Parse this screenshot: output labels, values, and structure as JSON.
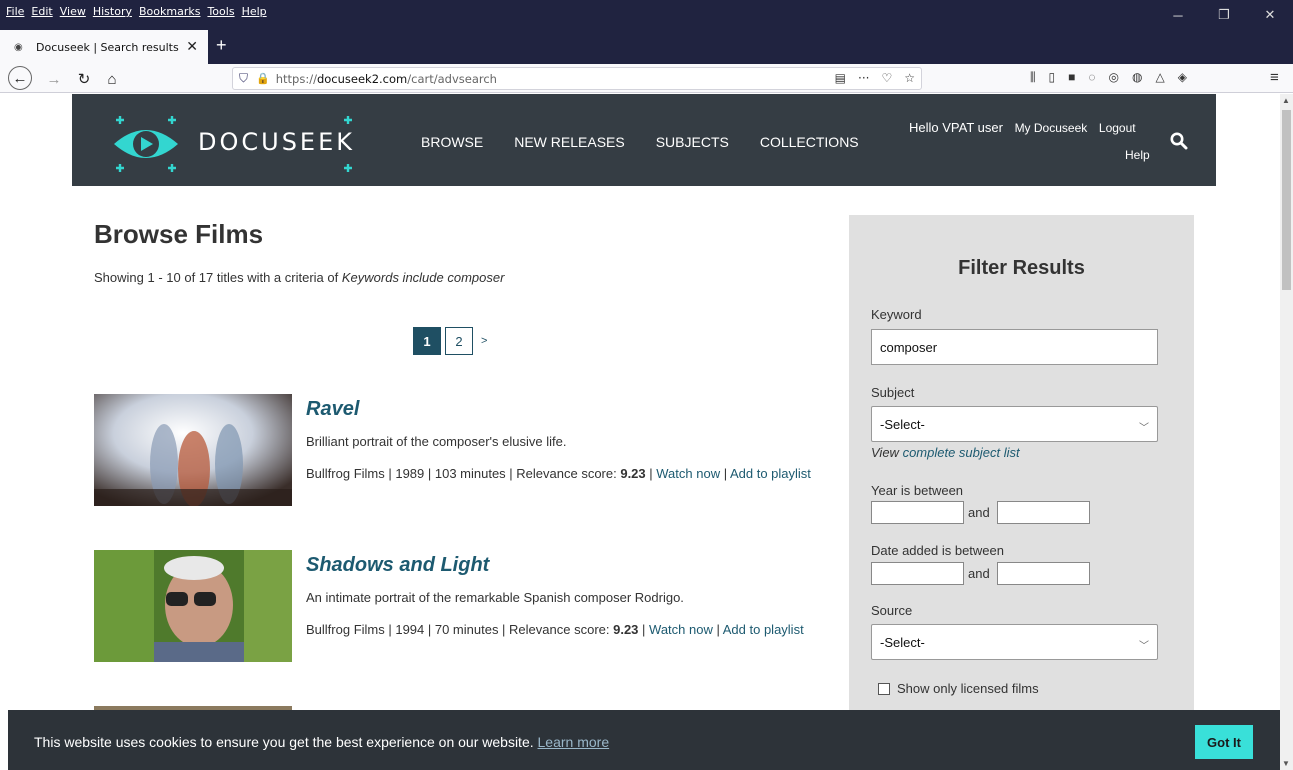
{
  "browser": {
    "menu": [
      "File",
      "Edit",
      "View",
      "History",
      "Bookmarks",
      "Tools",
      "Help"
    ],
    "tab_title": "Docuseek | Search results",
    "url_prefix": "https://",
    "url_domain": "docuseek2.com",
    "url_path": "/cart/advsearch",
    "url_more": "···"
  },
  "header": {
    "logo_text": "DOCUSEEK",
    "nav": [
      "BROWSE",
      "NEW RELEASES",
      "SUBJECTS",
      "COLLECTIONS"
    ],
    "greeting": "Hello VPAT user",
    "my_docuseek": "My Docuseek",
    "logout": "Logout",
    "help": "Help"
  },
  "main": {
    "title": "Browse Films",
    "showing": "Showing 1 - 10 of 17 titles with a criteria of ",
    "criteria": "Keywords include composer",
    "pager": {
      "current": "1",
      "other": "2",
      "next": ">"
    },
    "films": [
      {
        "title": "Ravel",
        "description": "Brilliant portrait of the composer's elusive life.",
        "meta": "Bullfrog Films | 1989 | 103 minutes | Relevance score: ",
        "score": "9.23",
        "sep": " | ",
        "watch": "Watch now",
        "add": "Add to playlist"
      },
      {
        "title": "Shadows and Light",
        "description": "An intimate portrait of the remarkable Spanish composer Rodrigo.",
        "meta": "Bullfrog Films | 1994 | 70 minutes | Relevance score: ",
        "score": "9.23",
        "sep": " | ",
        "watch": "Watch now",
        "add": "Add to playlist"
      }
    ]
  },
  "filter": {
    "heading": "Filter Results",
    "keyword_label": "Keyword",
    "keyword_value": "composer",
    "subject_label": "Subject",
    "subject_value": "-Select-",
    "view_text": "View ",
    "subject_link": "complete subject list",
    "year_label": "Year is between",
    "and": "and",
    "date_label": "Date added is between",
    "source_label": "Source",
    "source_value": "-Select-",
    "licensed_label": "Show only licensed films"
  },
  "cookie": {
    "message": "This website uses cookies to ensure you get the best experience on our website. ",
    "learn_more": "Learn more",
    "button": "Got It"
  }
}
